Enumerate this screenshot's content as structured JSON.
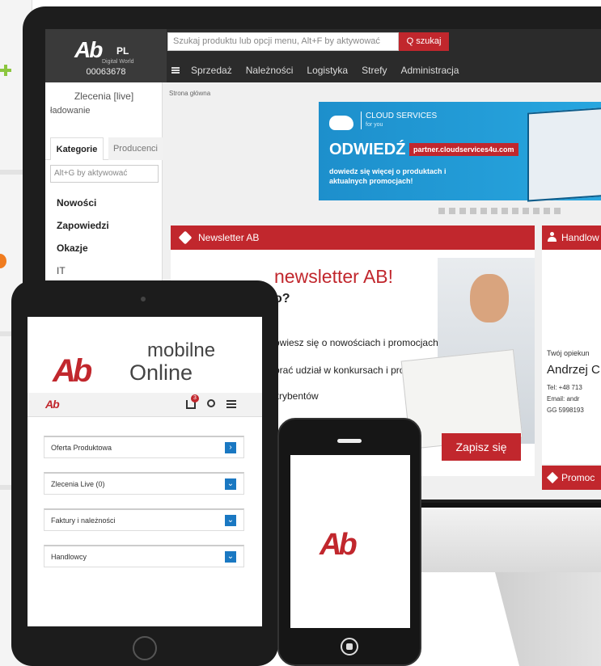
{
  "desktop": {
    "client_number": "00063678",
    "logo_suffix": "PL",
    "logo_tagline": "Digital World",
    "search": {
      "placeholder": "Szukaj produktu lub opcji menu, Alt+F by aktywować",
      "button": "Q szukaj"
    },
    "nav": [
      "Sprzedaż",
      "Należności",
      "Logistyka",
      "Strefy",
      "Administracja"
    ],
    "sidebar": {
      "live": "Zlecenia [live]",
      "loading": "ładowanie",
      "tabs": [
        "Kategorie",
        "Producenci"
      ],
      "filter_placeholder": "Alt+G by aktywować",
      "categories": [
        "Nowości",
        "Zapowiedzi",
        "Okazje",
        "IT"
      ]
    },
    "breadcrumb": "Strona główna",
    "banner": {
      "cloud": "CLOUD SERVICES",
      "cloud_sub": "for you",
      "headline": "ODWIEDŹ",
      "partner": "partner.cloudservices4u.com",
      "more": "dowiedz się więcej o produktach i aktualnych promocjach!"
    },
    "newsletter": {
      "header": "Newsletter AB",
      "title": "newsletter AB!",
      "question": "o?",
      "lines": [
        "owiesz się o nowościach i promocjach",
        "brać udział w konkursach i promocjach",
        "krybentów"
      ],
      "button": "Zapisz się"
    },
    "handlowiec": {
      "header": "Handlow",
      "opiekun": "Twój opiekun",
      "name": "Andrzej C",
      "tel": "Tel: +48 713",
      "email": "Email: andr",
      "gg": "GG 5998193"
    },
    "promo_header": "Promoc"
  },
  "tablet": {
    "brand_top": "mobilne",
    "brand_bottom": "Online",
    "cart_count": "3",
    "menu": [
      "Oferta Produktowa",
      "Zlecenia Live (0)",
      "Faktury i należności",
      "Handlowcy"
    ]
  },
  "colors": {
    "brand_red": "#c1272d",
    "banner_blue": "#1d8fcc",
    "chevron_blue": "#1a78c2"
  }
}
